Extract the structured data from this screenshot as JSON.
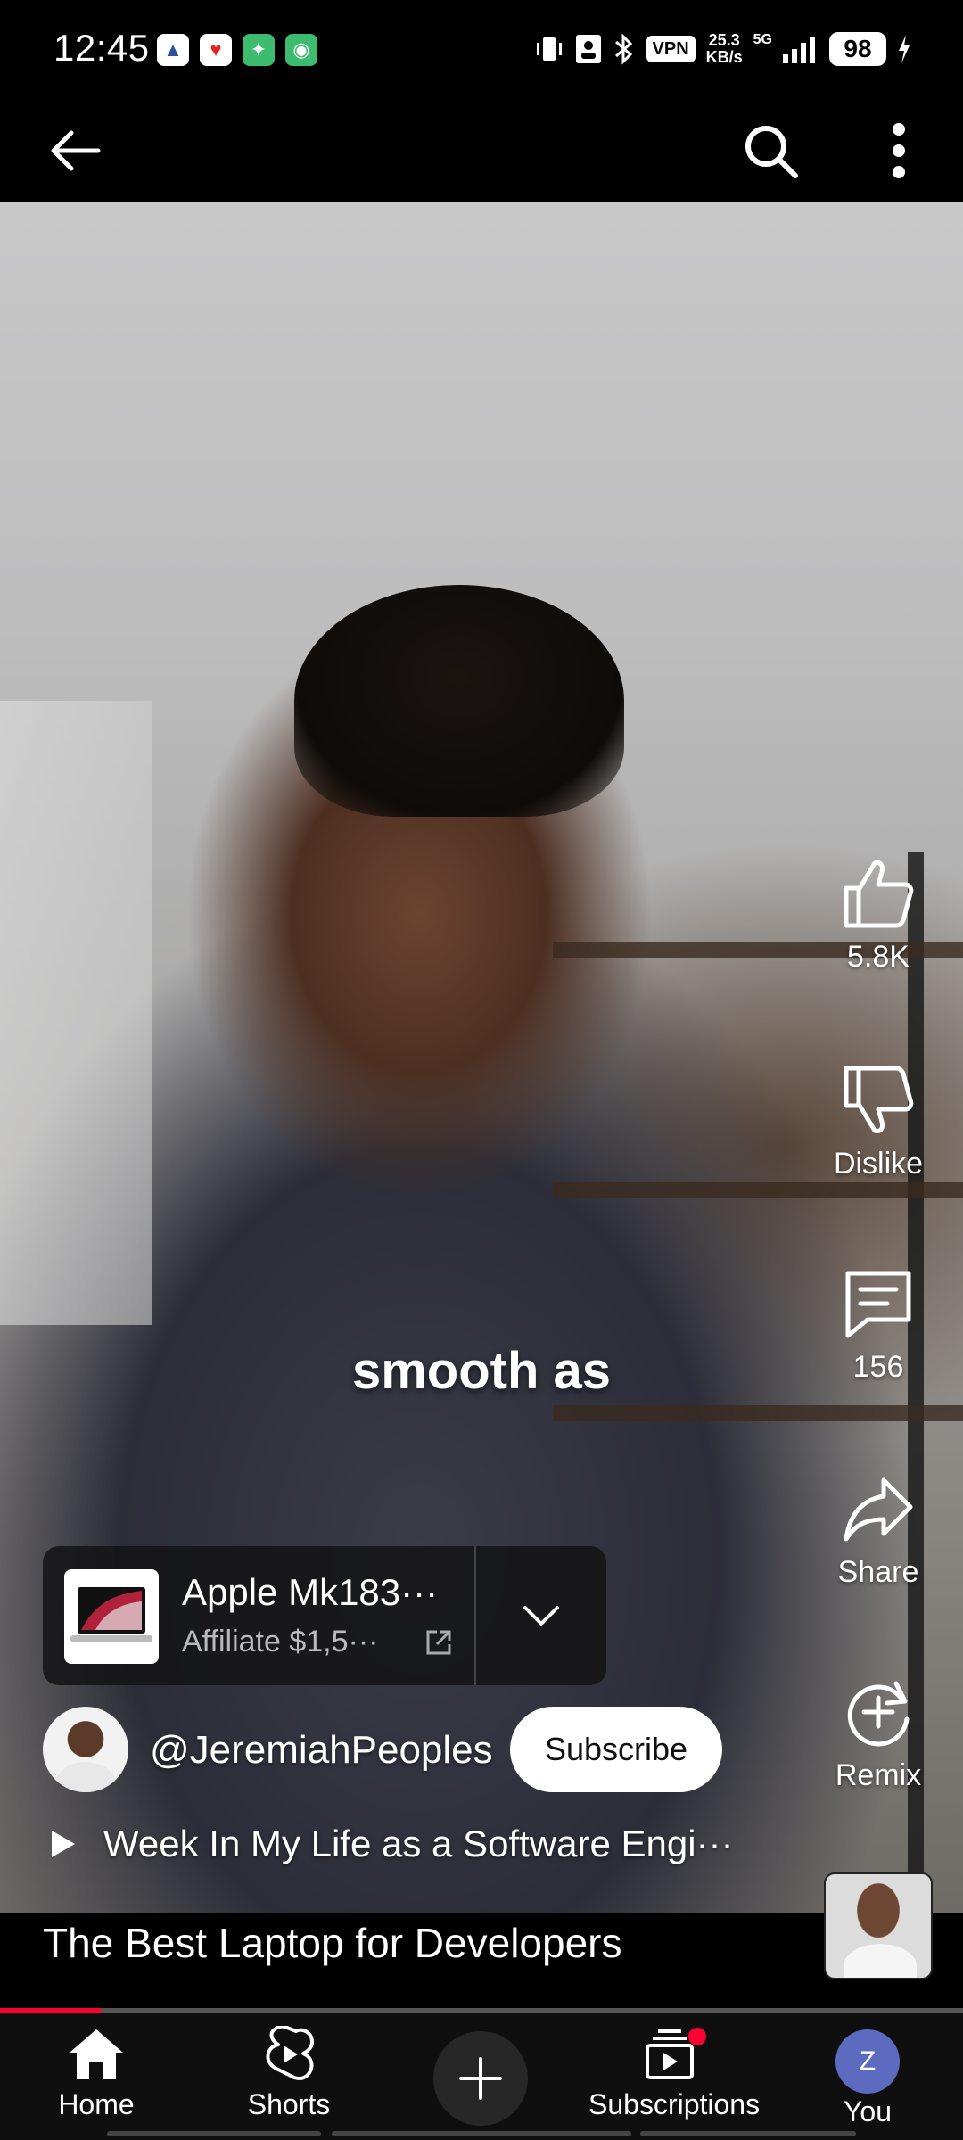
{
  "status_bar": {
    "time": "12:45",
    "vpn": "VPN",
    "net_speed_value": "25.3",
    "net_speed_unit": "KB/s",
    "network": "5G",
    "battery": "98"
  },
  "caption": "smooth as",
  "actions": {
    "like_count": "5.8K",
    "dislike_label": "Dislike",
    "comment_count": "156",
    "share_label": "Share",
    "remix_label": "Remix"
  },
  "product": {
    "title": "Apple Mk183···",
    "subtitle": "Affiliate $1,5···"
  },
  "channel": {
    "name": "@JeremiahPeoples",
    "subscribe_label": "Subscribe"
  },
  "playlist": {
    "title": "Week In My Life as a Software Engi···"
  },
  "video": {
    "title": "The Best Laptop for Developers",
    "progress": 0.105
  },
  "nav": {
    "home": "Home",
    "shorts": "Shorts",
    "subscriptions": "Subscriptions",
    "you": "You",
    "you_initial": "Z"
  },
  "colors": {
    "accent": "#ff0033",
    "you_avatar": "#5c6bc0"
  }
}
